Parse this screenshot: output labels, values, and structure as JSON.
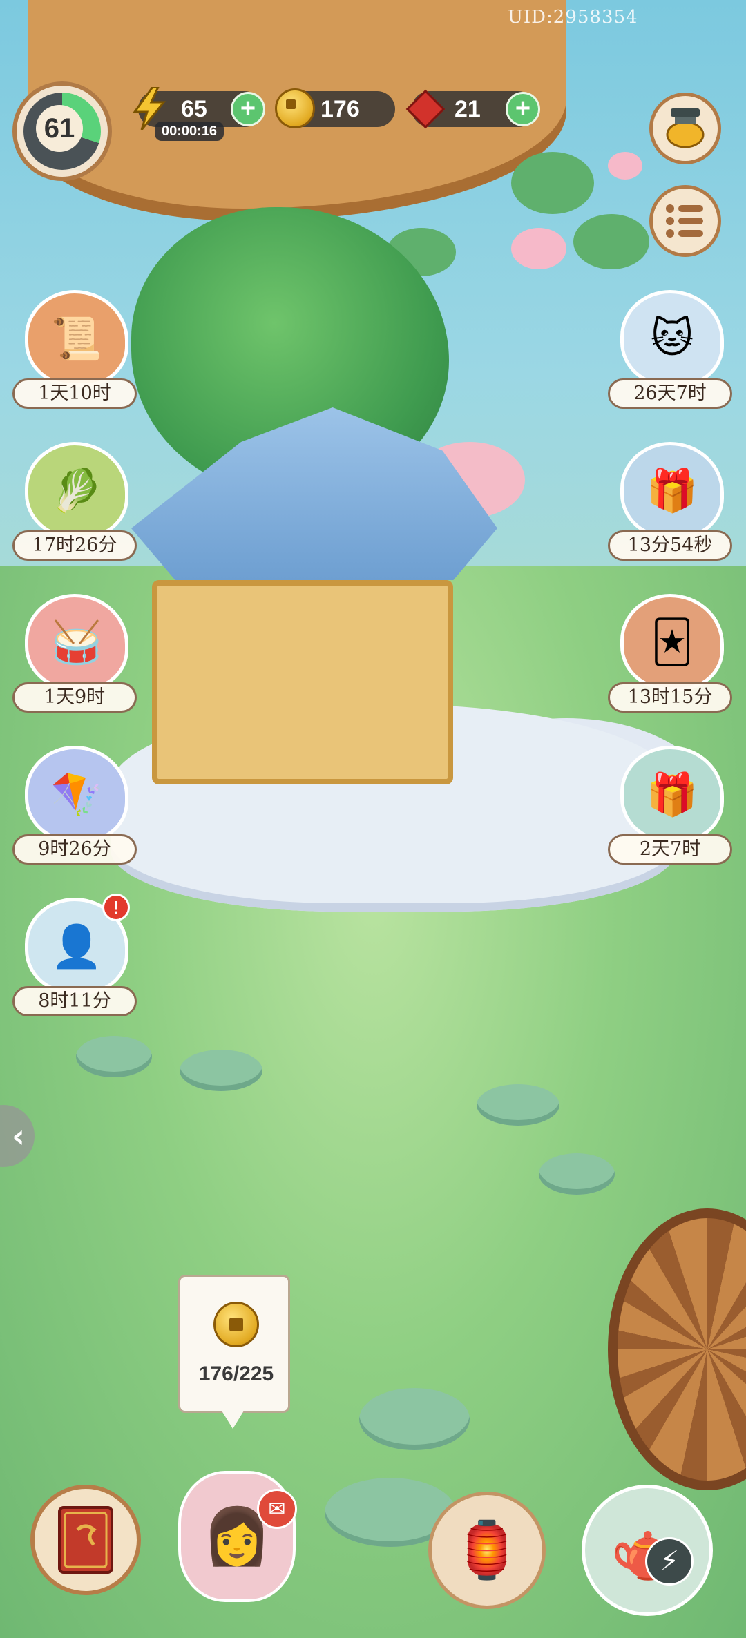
{
  "header": {
    "uid": "UID:2958354",
    "level": "61",
    "energy": {
      "value": "65",
      "timer": "00:00:16"
    },
    "coins": {
      "value": "176"
    },
    "gems": {
      "value": "21"
    }
  },
  "left_timers": [
    {
      "icon": "recipe-book-icon",
      "time": "1天10时"
    },
    {
      "icon": "vegetable-basket-icon",
      "time": "17时26分"
    },
    {
      "icon": "cat-drum-icon",
      "time": "1天9时"
    },
    {
      "icon": "kite-icon",
      "time": "9时26分"
    },
    {
      "icon": "character-portrait-icon",
      "time": "8时11分",
      "alert": "!"
    }
  ],
  "right_timers": [
    {
      "icon": "cat-broom-icon",
      "time": "26天7时"
    },
    {
      "icon": "blue-treasure-box-icon",
      "time": "13分54秒"
    },
    {
      "icon": "playing-cards-icon",
      "time": "13时15分"
    },
    {
      "icon": "cat-gift-box-icon",
      "time": "2天7时"
    }
  ],
  "coin_storage": {
    "amount": "176/225",
    "icon": "coin-icon"
  },
  "colors": {
    "plus_button": "#5cc56f",
    "pill_background": "#28292f",
    "alert": "#e23a2c",
    "level_progress": "#5ad27a"
  }
}
